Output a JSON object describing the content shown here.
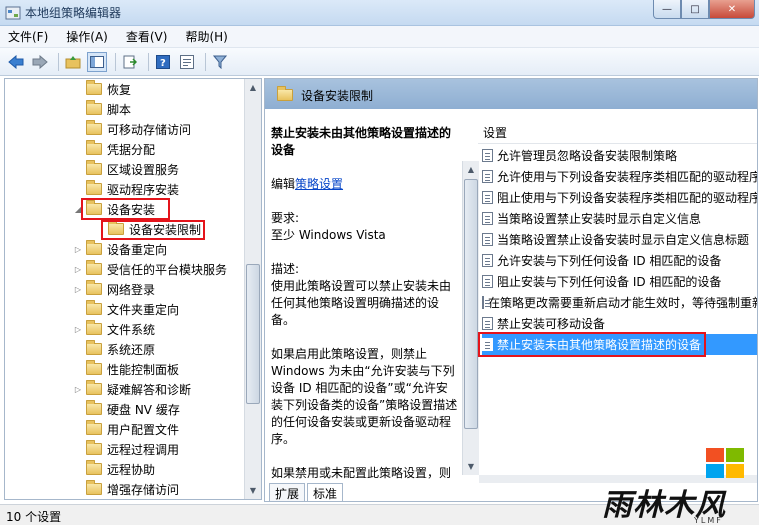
{
  "window": {
    "title": "本地组策略编辑器",
    "min": "—",
    "max": "□",
    "close": "✕"
  },
  "menubar": {
    "items": [
      "文件(F)",
      "操作(A)",
      "查看(V)",
      "帮助(H)"
    ]
  },
  "tree": {
    "items": [
      {
        "label": "恢复",
        "expander": ""
      },
      {
        "label": "脚本",
        "expander": ""
      },
      {
        "label": "可移动存储访问",
        "expander": ""
      },
      {
        "label": "凭据分配",
        "expander": ""
      },
      {
        "label": "区域设置服务",
        "expander": ""
      },
      {
        "label": "驱动程序安装",
        "expander": ""
      },
      {
        "label": "设备安装",
        "expander": "◢"
      },
      {
        "label": "设备安装限制",
        "expander": ""
      },
      {
        "label": "设备重定向",
        "expander": "▷"
      },
      {
        "label": "受信任的平台模块服务",
        "expander": "▷"
      },
      {
        "label": "网络登录",
        "expander": "▷"
      },
      {
        "label": "文件夹重定向",
        "expander": ""
      },
      {
        "label": "文件系统",
        "expander": "▷"
      },
      {
        "label": "系统还原",
        "expander": ""
      },
      {
        "label": "性能控制面板",
        "expander": ""
      },
      {
        "label": "疑难解答和诊断",
        "expander": "▷"
      },
      {
        "label": "硬盘 NV 缓存",
        "expander": ""
      },
      {
        "label": "用户配置文件",
        "expander": ""
      },
      {
        "label": "远程过程调用",
        "expander": ""
      },
      {
        "label": "远程协助",
        "expander": ""
      },
      {
        "label": "增强存储访问",
        "expander": ""
      }
    ]
  },
  "detail": {
    "header": "设备安装限制",
    "desc_title": "禁止安装未由其他策略设置描述的设备",
    "edit_prefix": "编辑",
    "edit_link": "策略设置",
    "req_label": "要求:",
    "req_value": "至少 Windows Vista",
    "desc_label": "描述:",
    "desc_body": "使用此策略设置可以禁止安装未由任何其他策略设置明确描述的设备。",
    "desc_more": "如果启用此策略设置，则禁止 Windows 为未由“允许安装与下列设备 ID 相匹配的设备”或“允许安装下列设备类的设备”策略设置描述的任何设备安装或更新设备驱动程序。",
    "desc_cut": "如果禁用或未配置此策略设置，则"
  },
  "settings": {
    "column_header": "设置",
    "items": [
      "允许管理员忽略设备安装限制策略",
      "允许使用与下列设备安装程序类相匹配的驱动程序",
      "阻止使用与下列设备安装程序类相匹配的驱动程序",
      "当策略设置禁止安装时显示自定义信息",
      "当策略设置禁止设备安装时显示自定义信息标题",
      "允许安装与下列任何设备 ID 相匹配的设备",
      "阻止安装与下列任何设备 ID 相匹配的设备",
      "在策略更改需要重新启动才能生效时，等待强制重新启动",
      "禁止安装可移动设备",
      "禁止安装未由其他策略设置描述的设备"
    ],
    "selected_index": 9
  },
  "tabs": [
    "扩展",
    "标准"
  ],
  "status": {
    "text": "10 个设置"
  },
  "watermark": {
    "text": "雨林木风",
    "sub": "YLMF"
  },
  "colors": {
    "selection": "#3399ff",
    "highlight_box": "#e4141b",
    "header": "#9bb7d8"
  }
}
